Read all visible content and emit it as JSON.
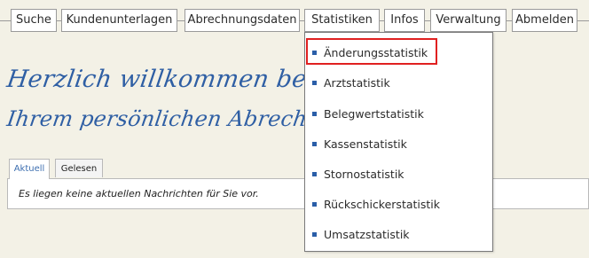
{
  "nav": {
    "items": [
      {
        "label": "Suche"
      },
      {
        "label": "Kundenunterlagen"
      },
      {
        "label": "Abrechnungsdaten"
      },
      {
        "label": "Statistiken"
      },
      {
        "label": "Infos"
      },
      {
        "label": "Verwaltung"
      },
      {
        "label": "Abmelden"
      }
    ]
  },
  "welcome": {
    "line1": "Herzlich willkommen bei der DZA",
    "line2": "Ihrem persönlichen Abrechnungshaus"
  },
  "tabs": [
    {
      "label": "Aktuell"
    },
    {
      "label": "Gelesen"
    }
  ],
  "panel": {
    "message": "Es liegen keine aktuellen Nachrichten für Sie vor."
  },
  "dropdown": {
    "items": [
      {
        "label": "Änderungsstatistik"
      },
      {
        "label": "Arztstatistik"
      },
      {
        "label": "Belegwertstatistik"
      },
      {
        "label": "Kassenstatistik"
      },
      {
        "label": "Stornostatistik"
      },
      {
        "label": "Rückschickerstatistik"
      },
      {
        "label": "Umsatzstatistik"
      }
    ]
  },
  "colors": {
    "background": "#f3f1e6",
    "accent": "#2f5fa4",
    "highlight": "#e02020"
  }
}
